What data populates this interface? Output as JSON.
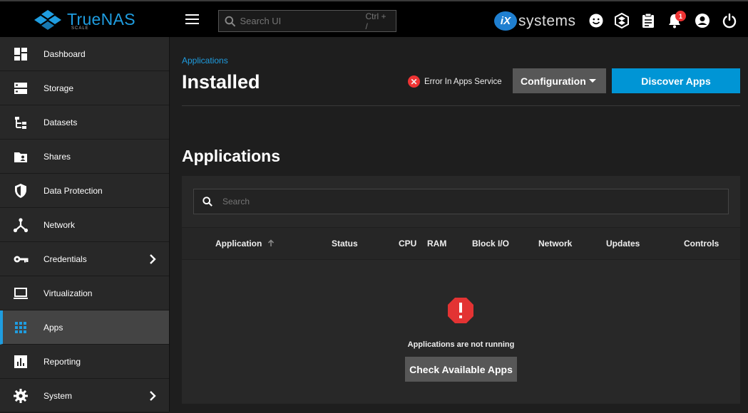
{
  "app": {
    "name": "TrueNAS",
    "edition": "SCALE",
    "vendor_mark": "iX",
    "vendor": "systems"
  },
  "topbar": {
    "search_placeholder": "Search UI",
    "search_shortcut": "Ctrl + /",
    "notification_count": "1",
    "icons": [
      "menu-icon",
      "search-icon",
      "feedback-icon",
      "truecommand-icon",
      "tasks-clipboard-icon",
      "bell-icon",
      "account-icon",
      "power-icon"
    ]
  },
  "sidebar": {
    "items": [
      {
        "label": "Dashboard",
        "icon": "dashboard-icon"
      },
      {
        "label": "Storage",
        "icon": "storage-icon"
      },
      {
        "label": "Datasets",
        "icon": "datasets-icon"
      },
      {
        "label": "Shares",
        "icon": "shares-icon"
      },
      {
        "label": "Data Protection",
        "icon": "shield-icon"
      },
      {
        "label": "Network",
        "icon": "network-icon"
      },
      {
        "label": "Credentials",
        "icon": "key-icon"
      },
      {
        "label": "Virtualization",
        "icon": "laptop-icon"
      },
      {
        "label": "Apps",
        "icon": "apps-grid-icon",
        "active": true
      },
      {
        "label": "Reporting",
        "icon": "reporting-icon"
      },
      {
        "label": "System",
        "icon": "gear-icon"
      }
    ]
  },
  "page": {
    "breadcrumb": "Applications",
    "title": "Installed",
    "error_status": "Error In Apps Service",
    "configuration_label": "Configuration",
    "discover_label": "Discover Apps",
    "section_title": "Applications",
    "table_search_placeholder": "Search",
    "columns": {
      "application": "Application",
      "status": "Status",
      "cpu": "CPU",
      "ram": "RAM",
      "block_io": "Block I/O",
      "network": "Network",
      "updates": "Updates",
      "controls": "Controls"
    },
    "empty_message": "Applications are not running",
    "check_apps_label": "Check Available Apps"
  },
  "colors": {
    "accent": "#0095d5",
    "error": "#e33333",
    "active_border": "#1f9de0"
  }
}
